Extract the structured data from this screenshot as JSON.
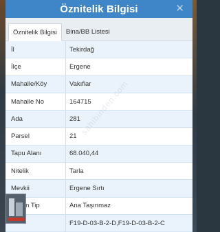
{
  "modal": {
    "title": "Öznitelik Bilgisi",
    "close_label": "✕"
  },
  "tabs": [
    {
      "label": "Öznitelik Bilgisi",
      "active": true
    },
    {
      "label": "Bina/BB Listesi",
      "active": false
    }
  ],
  "rows": [
    {
      "label": "İl",
      "value": "Tekirdağ"
    },
    {
      "label": "İlçe",
      "value": "Ergene"
    },
    {
      "label": "Mahalle/Köy",
      "value": "Vakıflar"
    },
    {
      "label": "Mahalle No",
      "value": "164715"
    },
    {
      "label": "Ada",
      "value": "281"
    },
    {
      "label": "Parsel",
      "value": "21"
    },
    {
      "label": "Tapu Alanı",
      "value": "68.040,44"
    },
    {
      "label": "Nitelik",
      "value": "Tarla"
    },
    {
      "label": "Mevkii",
      "value": "Ergene Sırtı"
    },
    {
      "label": "Zemin Tip",
      "value": "Ana Taşınmaz"
    },
    {
      "label": "",
      "value": "F19-D-03-B-2-D,F19-D-03-B-2-C"
    }
  ],
  "watermark": "sahibinden.com",
  "colors": {
    "header": "#3f86c8",
    "tab_bar": "#e9eef3",
    "row_alt": "#eaf3fb"
  }
}
